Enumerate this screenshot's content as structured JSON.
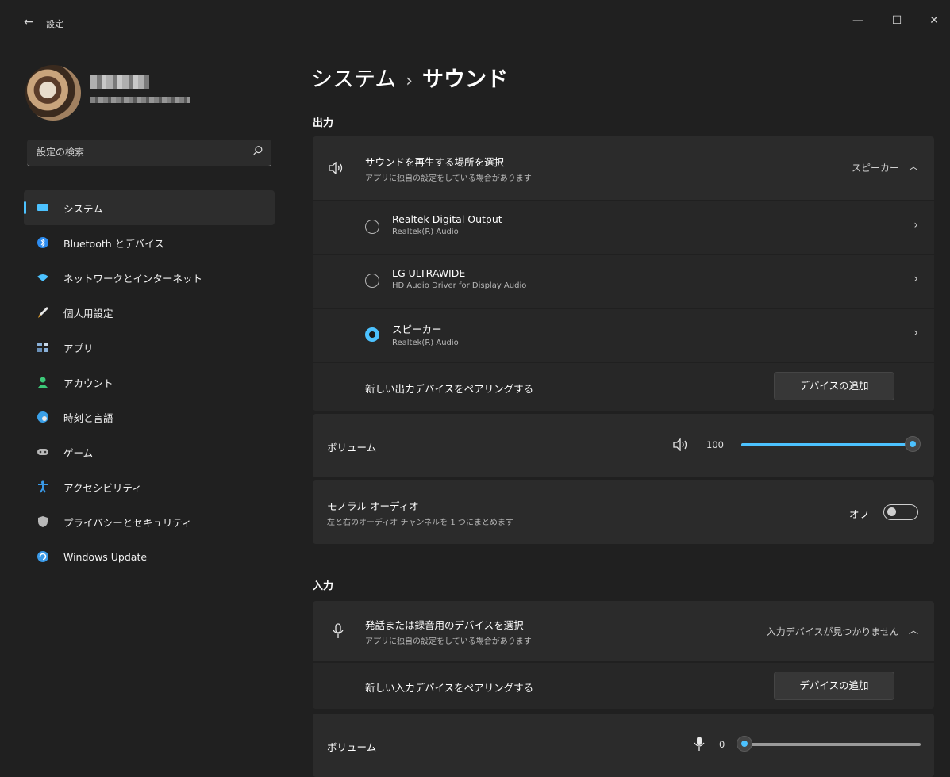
{
  "titlebar": {
    "back": "←",
    "title": "設定",
    "minimize": "—",
    "maximize": "☐",
    "close": "✕"
  },
  "search": {
    "placeholder": "設定の検索"
  },
  "nav": [
    {
      "label": "システム",
      "icon": "display-icon",
      "color": "#4cc2ff",
      "active": true
    },
    {
      "label": "Bluetooth とデバイス",
      "icon": "bluetooth-icon",
      "color": "#2d8cf0"
    },
    {
      "label": "ネットワークとインターネット",
      "icon": "wifi-icon",
      "color": "#4cc2ff"
    },
    {
      "label": "個人用設定",
      "icon": "brush-icon",
      "color": "#f0a830"
    },
    {
      "label": "アプリ",
      "icon": "apps-icon",
      "color": "#8ab0d8"
    },
    {
      "label": "アカウント",
      "icon": "person-icon",
      "color": "#3cc878"
    },
    {
      "label": "時刻と言語",
      "icon": "globe-clock-icon",
      "color": "#3aa0e8"
    },
    {
      "label": "ゲーム",
      "icon": "gamepad-icon",
      "color": "#b8b8b8"
    },
    {
      "label": "アクセシビリティ",
      "icon": "accessibility-icon",
      "color": "#3a9ae8"
    },
    {
      "label": "プライバシーとセキュリティ",
      "icon": "shield-icon",
      "color": "#b8b8b8"
    },
    {
      "label": "Windows Update",
      "icon": "update-icon",
      "color": "#3a9ae8"
    }
  ],
  "breadcrumb": {
    "parent": "システム",
    "separator": "›",
    "current": "サウンド"
  },
  "output": {
    "section": "出力",
    "select_title": "サウンドを再生する場所を選択",
    "select_sub": "アプリに独自の設定をしている場合があります",
    "selected": "スピーカー",
    "devices": [
      {
        "name": "Realtek Digital Output",
        "driver": "Realtek(R) Audio",
        "selected": false
      },
      {
        "name": "LG ULTRAWIDE",
        "driver": "HD Audio Driver for Display Audio",
        "selected": false
      },
      {
        "name": "スピーカー",
        "driver": "Realtek(R) Audio",
        "selected": true
      }
    ],
    "pair_label": "新しい出力デバイスをペアリングする",
    "add_button": "デバイスの追加",
    "volume_label": "ボリューム",
    "volume_value": "100",
    "volume_fraction": 1.0,
    "mono_title": "モノラル オーディオ",
    "mono_sub": "左と右のオーディオ チャンネルを 1 つにまとめます",
    "mono_state": "オフ"
  },
  "input": {
    "section": "入力",
    "select_title": "発話または録音用のデバイスを選択",
    "select_sub": "アプリに独自の設定をしている場合があります",
    "status": "入力デバイスが見つかりません",
    "pair_label": "新しい入力デバイスをペアリングする",
    "add_button": "デバイスの追加",
    "volume_label": "ボリューム",
    "volume_value": "0",
    "volume_fraction": 0.0
  },
  "colors": {
    "accent": "#4cc2ff",
    "background": "#202020",
    "card": "#2b2b2b"
  }
}
